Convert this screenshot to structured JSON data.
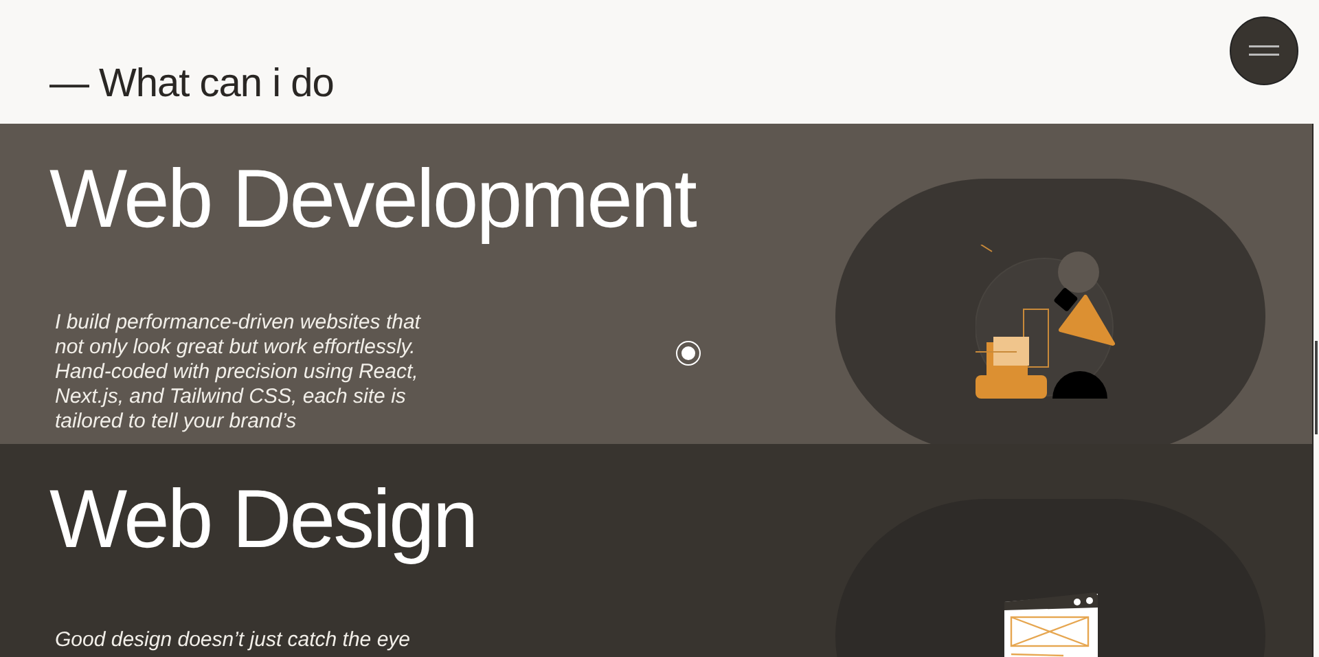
{
  "header": {
    "heading": "— What can i do"
  },
  "services": [
    {
      "kind": "development",
      "title": "Web Development",
      "description": "I build performance-driven websites that not only look great but work effortlessly. Hand-coded with precision using React, Next.js, and Tailwind CSS, each site is tailored to tell your brand’s"
    },
    {
      "kind": "design",
      "title": "Web Design",
      "description": "Good design doesn’t just catch the eye"
    }
  ]
}
